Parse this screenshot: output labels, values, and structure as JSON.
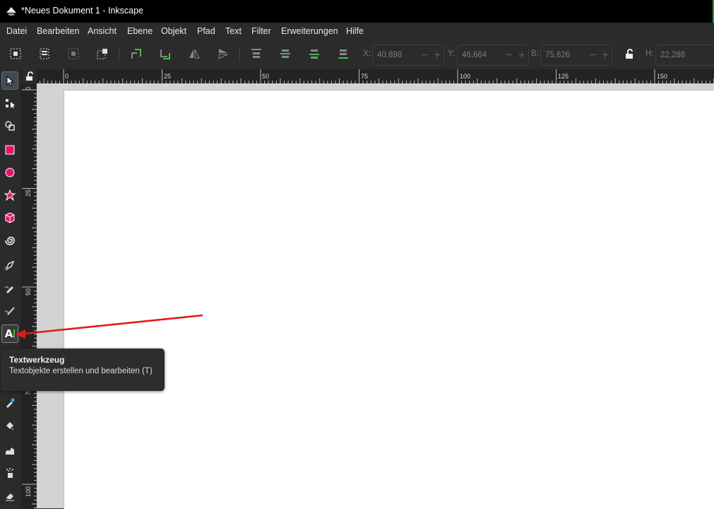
{
  "window": {
    "title": "*Neues Dokument 1 - Inkscape"
  },
  "menu": [
    "Datei",
    "Bearbeiten",
    "Ansicht",
    "Ebene",
    "Objekt",
    "Pfad",
    "Text",
    "Filter",
    "Erweiterungen",
    "Hilfe"
  ],
  "controls": {
    "x_label": "X:",
    "x_value": "40,898",
    "y_label": "Y:",
    "y_value": "46,664",
    "w_label": "B:",
    "w_value": "75,626",
    "h_label": "H:",
    "h_value": "22,288"
  },
  "ruler": {
    "h_labels": [
      "0",
      "25",
      "50",
      "75",
      "100",
      "125",
      "150"
    ],
    "v_labels": [
      "0",
      "25",
      "50",
      "75",
      "100"
    ]
  },
  "tooltip": {
    "title": "Textwerkzeug",
    "description": "Textobjekte erstellen und bearbeiten (T)"
  },
  "colors": {
    "accent_arrow": "#e21b1b",
    "tool_pink": "#e8136b",
    "tool_green": "#3fbf3f"
  }
}
